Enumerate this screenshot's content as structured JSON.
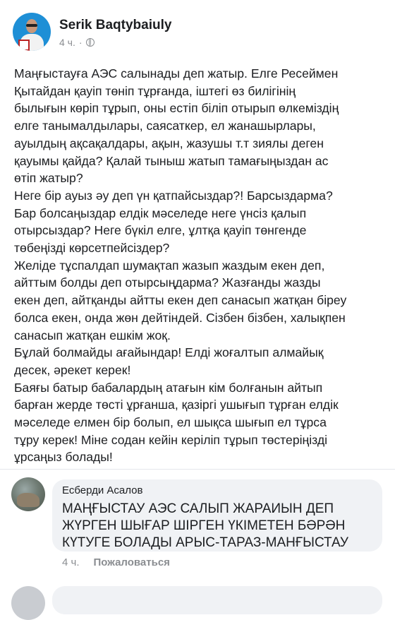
{
  "post": {
    "author": "Serik Baqtybaiuly",
    "time": "4 ч.",
    "separator": "·",
    "body": "Маңғыстауға АЭС салынады деп жатыр. Елге Ресеймен\nҚытайдан қауіп төніп тұрғанда, іштегі өз билігінің\nбылығын көріп тұрып, оны естіп біліп отырып өлкеміздің\nелге танымалдылары, саясаткер, ел жанашырлары,\nауылдың ақсақалдары, ақын, жазушы т.т зиялы деген\nқауымы қайда? Қалай тыныш жатып тамағыңыздан ас\nөтіп жатыр?\nНеге бір ауыз әу деп үн қатпайсыздар?! Барсыздарма?\nБар болсаңыздар елдік мәселеде неге үнсіз қалып\nотырсыздар? Неге бүкіл елге, ұлтқа қауіп төнгенде\nтөбеңізді көрсетпейсіздер?\nЖеліде тұспалдап шумақтап жазып жаздым екен деп,\nайттым болды деп отырсыңдарма? Жазғанды жазды\nекен деп, айтқанды айтты екен деп санасып жатқан біреу\nболса екен, онда жөн дейтіндей. Сізбен бізбен, халықпен\nсанасып жатқан ешкім жоқ.\nБұлай болмайды ағайындар! Елді жоғалтып алмайық\nдесек, әрекет керек!\nБаяғы батыр бабалардың атағын кім болғанын айтып\nбарған жерде төсті ұрғанша, қазіргі ушығып тұрған елдік\nмәселеде елмен бір болып, ел шықса шығып ел тұрса\nтұру керек! Міне содан кейін керіліп тұрып төстеріңізді\nұрсаңыз болады!"
  },
  "comment": {
    "author": "Есберди Асалов",
    "text": "МАҢҒЫСТАУ АЭС САЛЫП ЖАРАИЫН ДЕП ЖҮРГЕН ШЫҒАР ШІРГЕН ҮКІМЕТЕН БӘРӘН КҮТУГЕ БОЛАДЫ АРЫС-ТАРАЗ-МАНҒЫСТАУ",
    "time": "4 ч.",
    "report_label": "Пожаловаться"
  },
  "colors": {
    "text": "#1c1e21",
    "secondary": "#8a8d91",
    "bubble": "#f0f2f5",
    "avatar_bg": "#1e8fd6"
  },
  "icons": {
    "audience": "globe-icon"
  }
}
